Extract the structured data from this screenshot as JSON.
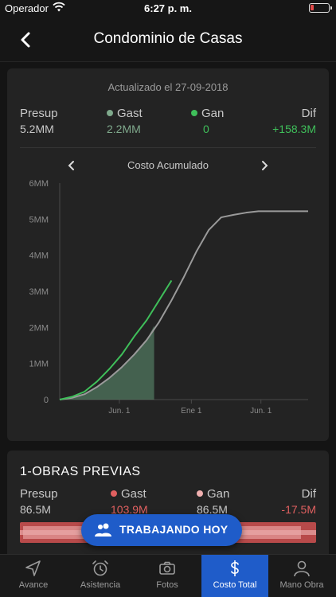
{
  "status_bar": {
    "carrier": "Operador",
    "time": "6:27 p. m.",
    "battery_level": 0.1
  },
  "nav": {
    "title": "Condominio de Casas",
    "back_icon": "chevron-left-icon"
  },
  "summary": {
    "updated": "Actualizado el 27-09-2018",
    "stats": [
      {
        "label": "Presup",
        "value": "5.2MM",
        "dot_color": ""
      },
      {
        "label": "Gast",
        "value": "2.2MM",
        "dot_color": "#7fa98c"
      },
      {
        "label": "Gan",
        "value": "0",
        "dot_color": "#3fbf5a"
      },
      {
        "label": "Dif",
        "value": "+158.3M",
        "dot_color": ""
      }
    ],
    "colors": {
      "label": "#c8c8c8",
      "gast_value": "#7fa98c",
      "gan_value": "#3fbf5a",
      "dif_value": "#3fbf5a"
    }
  },
  "chart": {
    "title": "Costo Acumulado",
    "prev_icon": "chevron-left-icon",
    "next_icon": "chevron-right-icon"
  },
  "chart_data": {
    "type": "line",
    "title": "Costo Acumulado",
    "xlabel": "",
    "ylabel": "",
    "x_tick_labels": [
      "Jun. 1",
      "Ene 1",
      "Jun. 1"
    ],
    "x_tick_positions": [
      0.24,
      0.53,
      0.81
    ],
    "y_ticks": [
      0,
      1,
      2,
      3,
      4,
      5,
      6
    ],
    "y_tick_labels": [
      "0",
      "1MM",
      "2MM",
      "3MM",
      "4MM",
      "5MM",
      "6MM"
    ],
    "ylim": [
      0,
      6
    ],
    "grid": false,
    "series": [
      {
        "color": "#9a9a9a",
        "x": [
          0,
          0.05,
          0.1,
          0.15,
          0.2,
          0.25,
          0.3,
          0.35,
          0.4,
          0.45,
          0.5,
          0.55,
          0.6,
          0.65,
          0.7,
          0.75,
          0.8,
          0.85,
          0.9,
          0.95,
          1.0
        ],
        "values": [
          0,
          0.05,
          0.15,
          0.35,
          0.6,
          0.9,
          1.25,
          1.65,
          2.15,
          2.75,
          3.4,
          4.1,
          4.7,
          5.05,
          5.12,
          5.18,
          5.22,
          5.22,
          5.22,
          5.22,
          5.22
        ]
      },
      {
        "color": "#3fbf5a",
        "x": [
          0,
          0.05,
          0.1,
          0.15,
          0.2,
          0.25,
          0.3,
          0.35,
          0.4,
          0.45
        ],
        "values": [
          0,
          0.08,
          0.22,
          0.5,
          0.85,
          1.25,
          1.75,
          2.2,
          2.75,
          3.3
        ]
      }
    ],
    "shaded_area": {
      "color": "#5a8a6c",
      "x": [
        0,
        0.05,
        0.1,
        0.15,
        0.2,
        0.25,
        0.3,
        0.35,
        0.38
      ],
      "values": [
        0,
        0.05,
        0.15,
        0.35,
        0.6,
        0.9,
        1.25,
        1.65,
        2.05
      ]
    }
  },
  "section": {
    "title": "1-OBRAS PREVIAS",
    "stats": [
      {
        "label": "Presup",
        "value": "86.5M",
        "dot_color": ""
      },
      {
        "label": "Gast",
        "value": "103.9M",
        "dot_color": "#e06060"
      },
      {
        "label": "Gan",
        "value": "86.5M",
        "dot_color": "#f0b0b0"
      },
      {
        "label": "Dif",
        "value": "-17.5M",
        "dot_color": ""
      }
    ],
    "colors": {
      "gast_value": "#e06060",
      "dif_value": "#e06060"
    },
    "progress_fraction": 0.96
  },
  "fab": {
    "label": "TRABAJANDO HOY",
    "icon": "people-icon"
  },
  "tabs": [
    {
      "label": "Avance",
      "icon": "navigation-arrow-icon",
      "active": false
    },
    {
      "label": "Asistencia",
      "icon": "alarm-clock-icon",
      "active": false
    },
    {
      "label": "Fotos",
      "icon": "camera-icon",
      "active": false
    },
    {
      "label": "Costo Total",
      "icon": "dollar-icon",
      "active": true
    },
    {
      "label": "Mano Obra",
      "icon": "person-icon",
      "active": false
    }
  ]
}
